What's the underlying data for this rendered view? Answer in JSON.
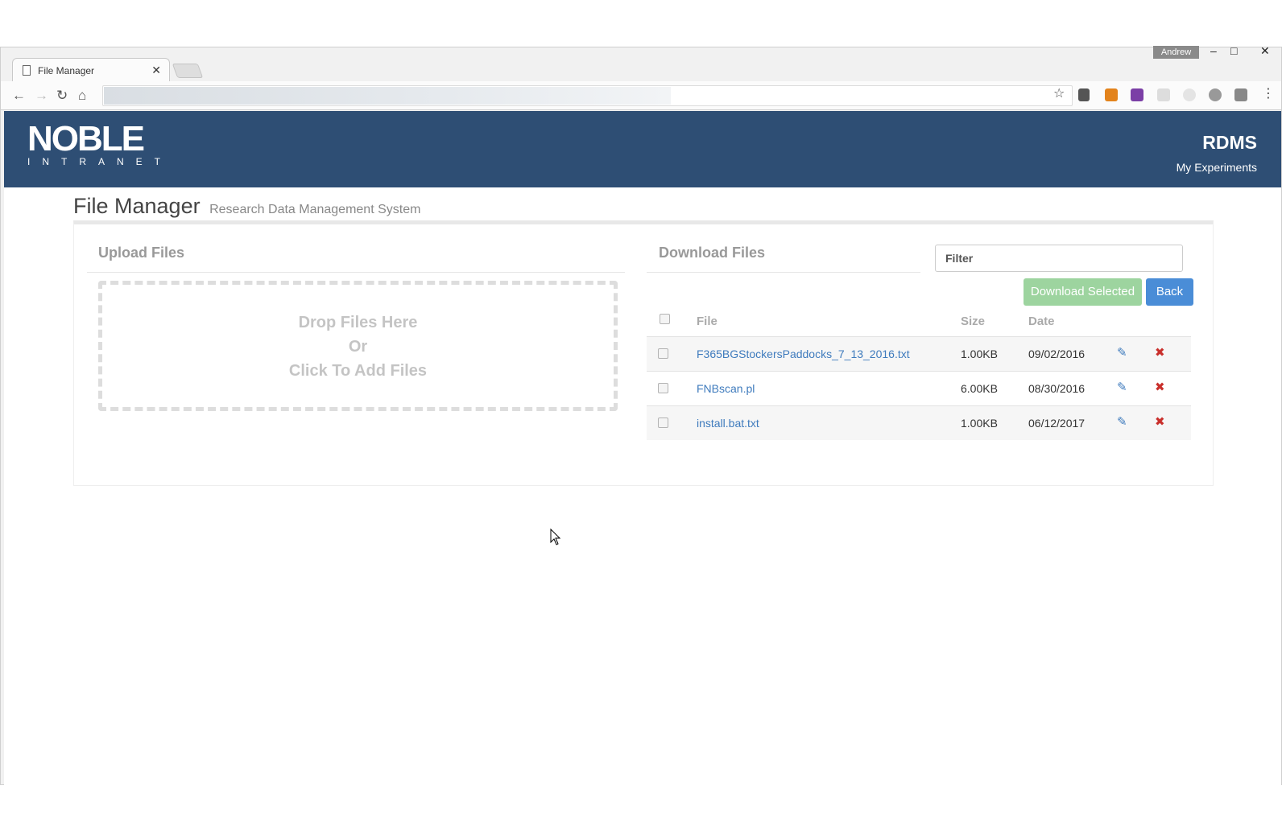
{
  "browser": {
    "tab_title": "File Manager",
    "tab_close": "✕",
    "profile_name": "Andrew",
    "minimize": "–",
    "maximize": "□",
    "close": "✕"
  },
  "header": {
    "logo_main": "NOBLE",
    "logo_sub": "INTRANET",
    "brand": "RDMS",
    "nav_link": "My Experiments"
  },
  "page": {
    "title": "File Manager",
    "subtitle": "Research Data Management System"
  },
  "upload": {
    "title": "Upload Files",
    "drop_line1": "Drop Files Here",
    "drop_line2": "Or",
    "drop_line3": "Click To Add Files"
  },
  "download": {
    "title": "Download Files",
    "filter_placeholder": "Filter",
    "download_selected": "Download Selected",
    "back": "Back",
    "columns": {
      "file": "File",
      "size": "Size",
      "date": "Date"
    },
    "rows": [
      {
        "file": "F365BGStockersPaddocks_7_13_2016.txt",
        "size": "1.00KB",
        "date": "09/02/2016"
      },
      {
        "file": "FNBscan.pl",
        "size": "6.00KB",
        "date": "08/30/2016"
      },
      {
        "file": "install.bat.txt",
        "size": "1.00KB",
        "date": "06/12/2017"
      }
    ]
  },
  "colors": {
    "header_bg": "#2e4e74",
    "link": "#3f7bbd",
    "download_btn": "#9dd49f",
    "back_btn": "#4a8dd7",
    "delete": "#c9302c"
  }
}
